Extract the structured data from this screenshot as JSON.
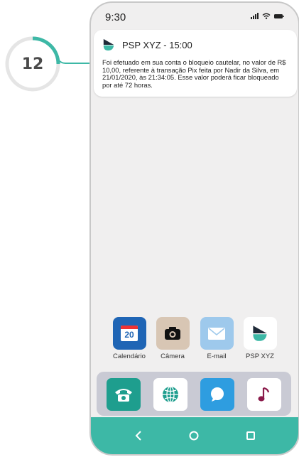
{
  "step_badge": {
    "number": "12",
    "accent_color": "#3db8a6",
    "ring_color": "#e5e5e5"
  },
  "status_bar": {
    "time": "9:30",
    "icons": [
      "signal-icon",
      "wifi-icon",
      "battery-icon"
    ]
  },
  "notification": {
    "app_icon": "psp-logo-icon",
    "title": "PSP XYZ - 15:00",
    "body": "Foi efetuado em sua conta o bloqueio cautelar, no valor de R$ 10,00, referente à transação Pix feita por Nadir da Silva, em 21/01/2020, às 21:34:05. Esse valor poderá ficar bloqueado por até 72 horas."
  },
  "home_apps": [
    {
      "label": "Calendário",
      "icon": "calendar-icon",
      "icon_text": "20",
      "color": "#1f65b5"
    },
    {
      "label": "Câmera",
      "icon": "camera-icon",
      "color": "#d8c6b4"
    },
    {
      "label": "E-mail",
      "icon": "mail-icon",
      "color": "#9ec9ec"
    },
    {
      "label": "PSP XYZ",
      "icon": "psp-logo-icon",
      "color": "#ffffff"
    }
  ],
  "dock": [
    {
      "icon": "phone-icon",
      "color": "#1e9e8e"
    },
    {
      "icon": "globe-icon",
      "color": "#ffffff"
    },
    {
      "icon": "chat-icon",
      "color": "#2e9de0"
    },
    {
      "icon": "music-icon",
      "color": "#ffffff"
    }
  ],
  "nav_bar": {
    "color": "#3db8a6",
    "buttons": [
      "back-icon",
      "home-icon",
      "recents-icon"
    ]
  }
}
